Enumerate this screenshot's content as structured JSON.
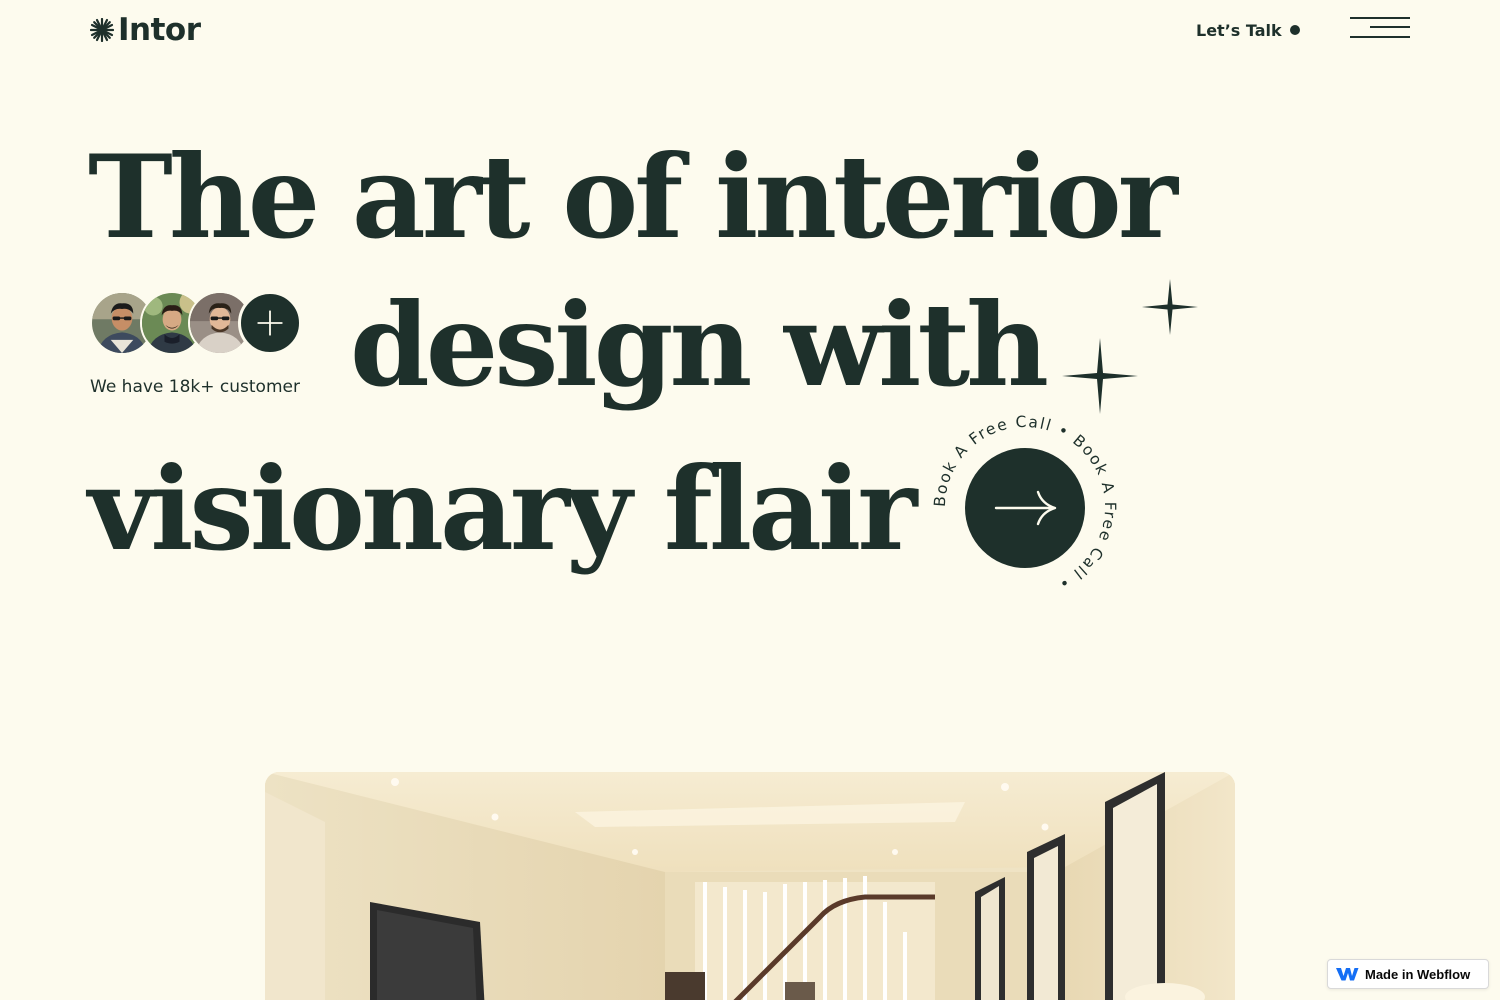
{
  "header": {
    "logo_text": "Intor",
    "logo_icon": "starburst-icon",
    "lets_talk_label": "Let’s Talk",
    "menu_icon": "hamburger-menu-icon"
  },
  "hero": {
    "headline_line1": "The art of interior",
    "headline_line2": "design with",
    "headline_line3": "visionary flair",
    "customer_text": "We have 18k+ customer",
    "avatar_count": 3,
    "plus_icon": "plus-icon",
    "sparkle_icon": "four-point-star-icon"
  },
  "cta": {
    "circular_text": "Book A Free Call • Book A Free Call •",
    "arrow_icon": "arrow-right-icon"
  },
  "badge": {
    "label": "Made in Webflow",
    "icon": "webflow-logo-icon"
  },
  "colors": {
    "background": "#fdfbee",
    "primary": "#1e302b",
    "badge_background": "#ffffff"
  }
}
